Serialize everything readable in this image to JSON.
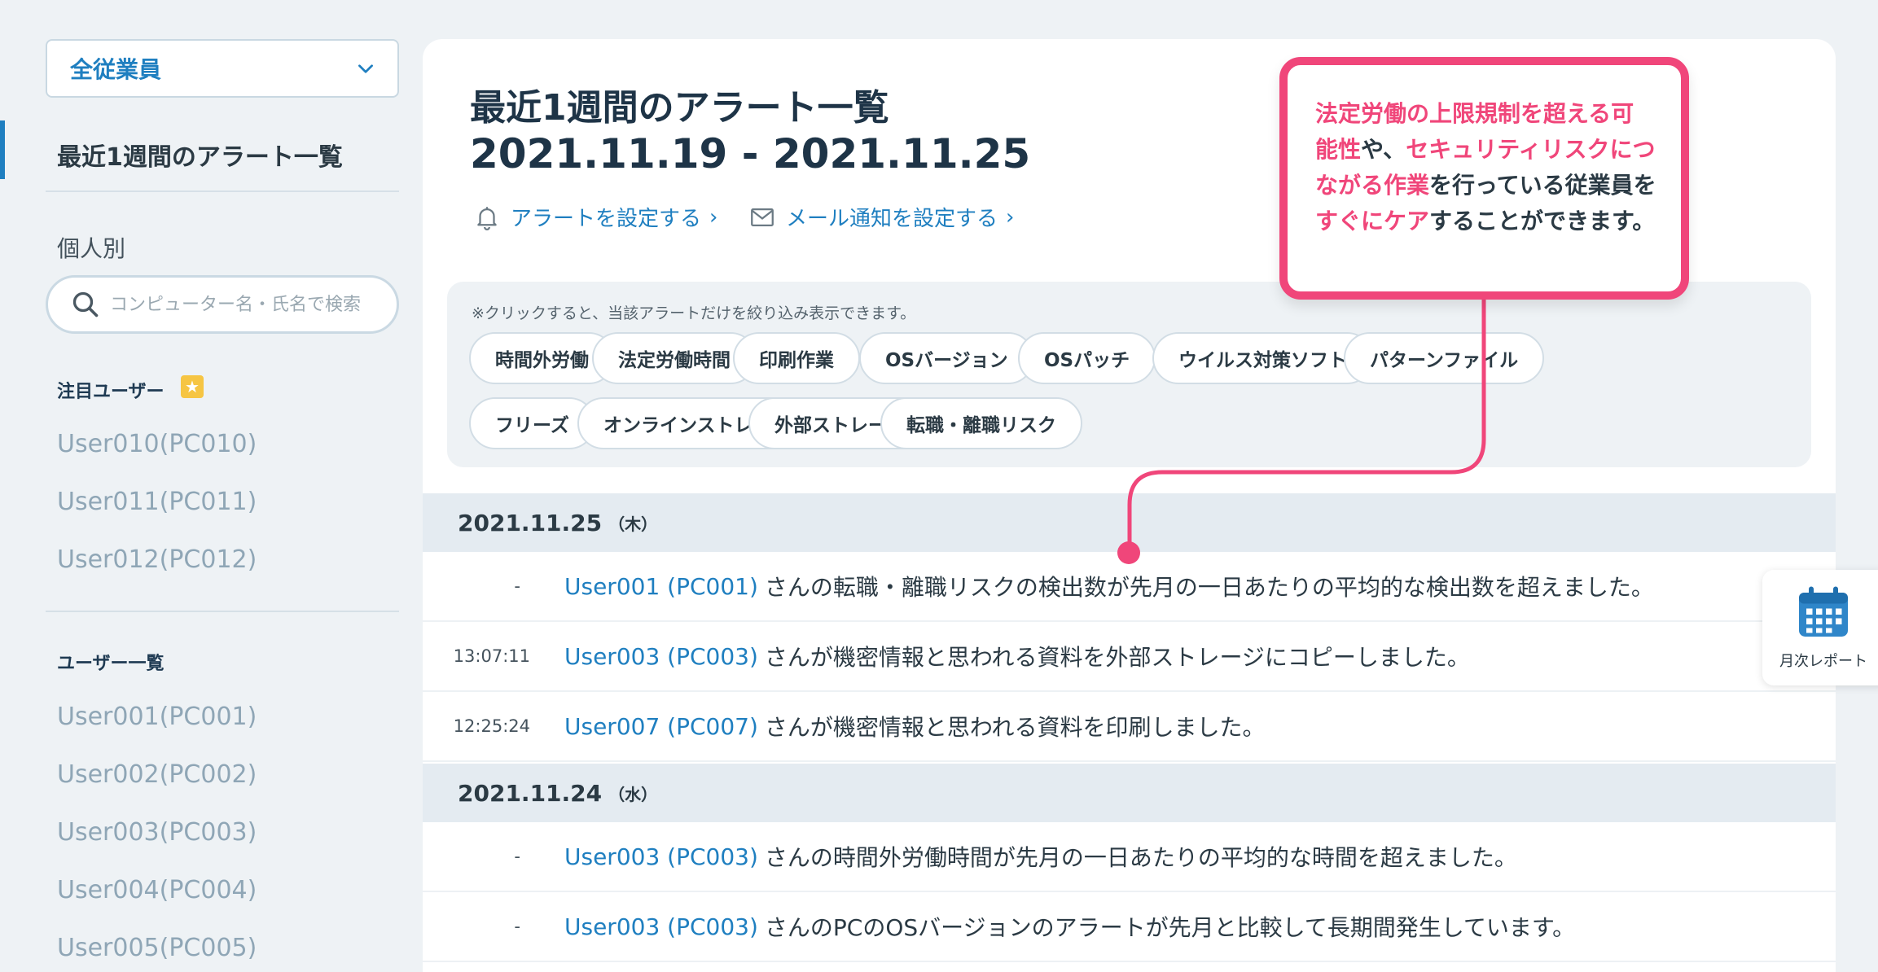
{
  "sidebar": {
    "dept_selector": "全従業員",
    "active_item": "最近1週間のアラート一覧",
    "individual_label": "個人別",
    "search_placeholder": "コンピューター名・氏名で検索",
    "featured_heading": "注目ユーザー",
    "featured_users": [
      "User010(PC010)",
      "User011(PC011)",
      "User012(PC012)"
    ],
    "user_list_heading": "ユーザー一覧",
    "users": [
      "User001(PC001)",
      "User002(PC002)",
      "User003(PC003)",
      "User004(PC004)",
      "User005(PC005)"
    ]
  },
  "main": {
    "title": "最近1週間のアラート一覧",
    "range": "2021.11.19 - 2021.11.25",
    "alert_setting_link": "アラートを設定する",
    "mail_setting_link": "メール通知を設定する",
    "filter_note": "※クリックすると、当該アラートだけを絞り込み表示できます。",
    "chips": [
      "時間外労働",
      "法定労働時間",
      "印刷作業",
      "OSバージョン",
      "OSパッチ",
      "ウイルス対策ソフト",
      "パターンファイル",
      "フリーズ",
      "オンラインストレージ",
      "外部ストレージ",
      "転職・離職リスク"
    ],
    "days": [
      {
        "date": "2021.11.25",
        "weekday": "（木）",
        "rows": [
          {
            "time": "-",
            "user": "User001 (PC001)",
            "msg": "さんの転職・離職リスクの検出数が先月の一日あたりの平均的な検出数を超えました。"
          },
          {
            "time": "13:07:11",
            "user": "User003 (PC003)",
            "msg": "さんが機密情報と思われる資料を外部ストレージにコピーしました。"
          },
          {
            "time": "12:25:24",
            "user": "User007 (PC007)",
            "msg": "さんが機密情報と思われる資料を印刷しました。"
          }
        ]
      },
      {
        "date": "2021.11.24",
        "weekday": "（水）",
        "rows": [
          {
            "time": "-",
            "user": "User003 (PC003)",
            "msg": "さんの時間外労働時間が先月の一日あたりの平均的な時間を超えました。"
          },
          {
            "time": "-",
            "user": "User003 (PC003)",
            "msg": "さんのPCのOSバージョンのアラートが先月と比較して長期間発生しています。"
          }
        ]
      }
    ]
  },
  "callout": {
    "p1": "法定労働の上限規制を超える可能性",
    "p2": "や、",
    "p3": "セキュリティリスクにつながる作業",
    "p4": "を行っている従業員を",
    "p5": "すぐにケア",
    "p6": "することができます。"
  },
  "monthly_report": {
    "label": "月次レポート"
  },
  "colors": {
    "accent": "#1f7fc0",
    "callout": "#f0467a",
    "muted_link": "#8fa6b6"
  }
}
